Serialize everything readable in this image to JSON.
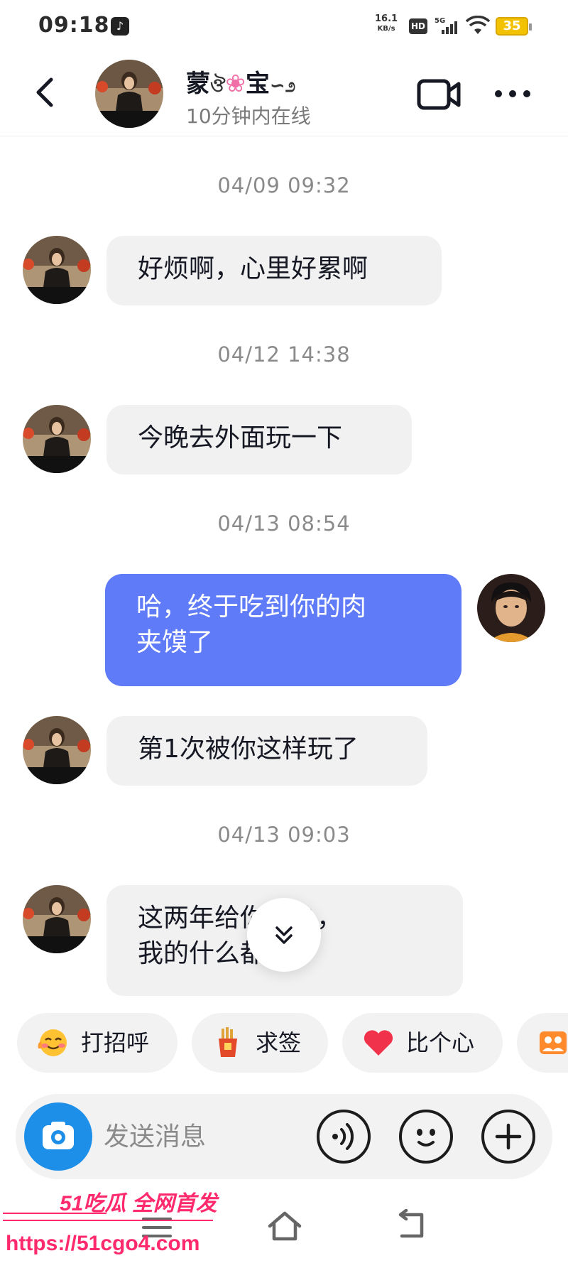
{
  "status_bar": {
    "time": "09:18",
    "net_speed_value": "16.1",
    "net_speed_unit": "KB/s",
    "hd_badge": "HD",
    "network": "5G",
    "battery": "35"
  },
  "header": {
    "contact_name_part1": "蒙",
    "contact_name_part2": "宝",
    "contact_status": "10分钟内在线"
  },
  "messages": [
    {
      "type": "timestamp",
      "text": "04/09 09:32"
    },
    {
      "type": "incoming",
      "text": "好烦啊，心里好累啊"
    },
    {
      "type": "timestamp",
      "text": "04/12 14:38"
    },
    {
      "type": "incoming",
      "text": "今晚去外面玩一下"
    },
    {
      "type": "timestamp",
      "text": "04/13 08:54"
    },
    {
      "type": "outgoing",
      "line1": "哈，终于吃到你的肉",
      "line2": "夹馍了"
    },
    {
      "type": "incoming",
      "text": "第1次被你这样玩了"
    },
    {
      "type": "timestamp",
      "text": "04/13 09:03"
    },
    {
      "type": "incoming",
      "line1": "这两年给你多少，",
      "line2": "我的什么都变了"
    }
  ],
  "quick_replies": [
    {
      "label": "打招呼",
      "icon": "smiling-face-icon"
    },
    {
      "label": "求签",
      "icon": "fortune-stick-icon"
    },
    {
      "label": "比个心",
      "icon": "heart-icon"
    },
    {
      "label": "",
      "icon": "group-photo-icon"
    }
  ],
  "input_bar": {
    "placeholder": "发送消息",
    "icons": [
      "camera-icon",
      "voice-icon",
      "emoji-icon",
      "plus-icon"
    ]
  },
  "watermark": {
    "line1": "51吃瓜 全网首发",
    "line2": "https://51cgo4.com"
  },
  "colors": {
    "outgoing_bubble": "#5f7bf7",
    "incoming_bubble": "#f1f1f2",
    "camera_button": "#1d8fe8",
    "watermark": "#ff2a6d"
  }
}
